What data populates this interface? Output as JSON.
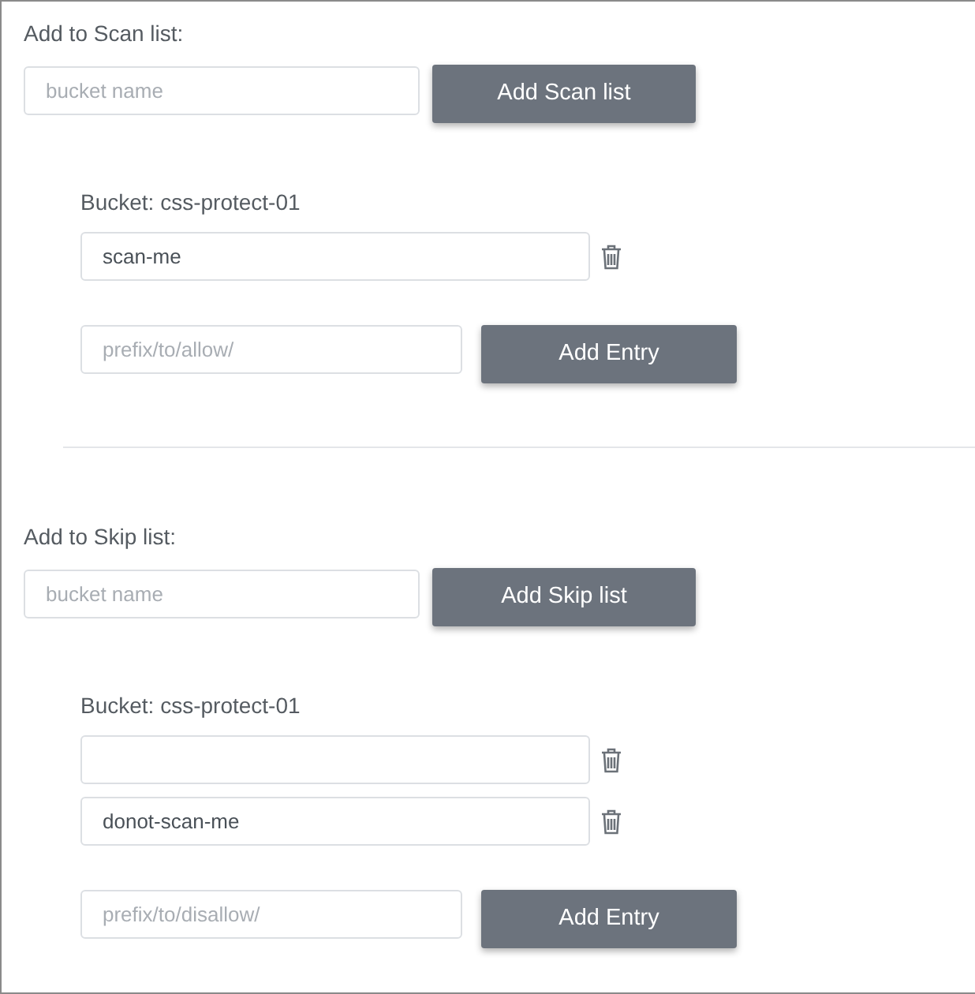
{
  "sections": [
    {
      "label": "Add to Scan list:",
      "bucket_input": {
        "placeholder": "bucket name"
      },
      "add_button": "Add Scan list",
      "bucket": {
        "title": "Bucket: css-protect-01",
        "entries": [
          {
            "kind": "text",
            "value": "scan-me"
          }
        ],
        "new_entry": {
          "placeholder": "prefix/to/allow/"
        },
        "add_button": "Add Entry"
      }
    },
    {
      "label": "Add to Skip list:",
      "bucket_input": {
        "placeholder": "bucket name"
      },
      "add_button": "Add Skip list",
      "bucket": {
        "title": "Bucket: css-protect-01",
        "entries": [
          {
            "kind": "blank"
          },
          {
            "kind": "text",
            "value": "donot-scan-me"
          }
        ],
        "new_entry": {
          "placeholder": "prefix/to/disallow/"
        },
        "add_button": "Add Entry"
      }
    }
  ]
}
